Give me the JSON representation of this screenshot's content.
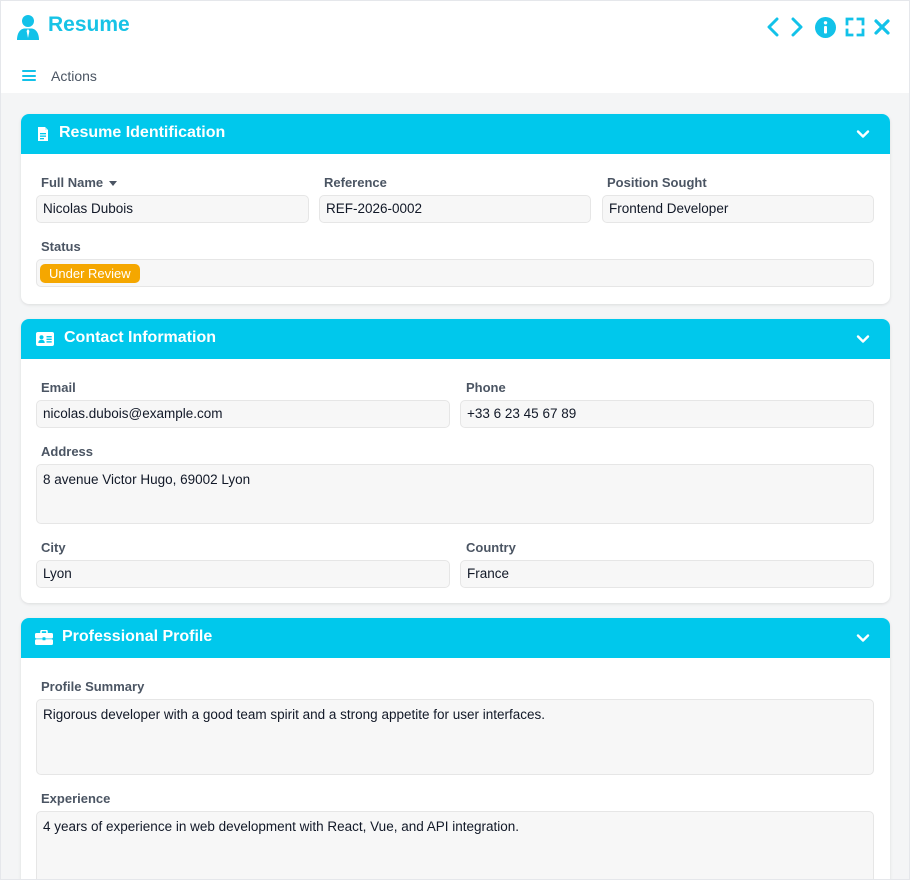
{
  "window": {
    "title": "Resume",
    "accent_color": "#00c8ec",
    "controls": [
      "chevron-left-icon",
      "chevron-right-icon",
      "info-icon",
      "fullscreen-icon",
      "close-icon"
    ]
  },
  "actions": {
    "label": "Actions"
  },
  "sections": {
    "identification": {
      "title": "Resume Identification",
      "icon": "document-icon",
      "full_name": {
        "label": "Full Name",
        "value": "Nicolas Dubois"
      },
      "reference": {
        "label": "Reference",
        "value": "REF-2026-0002"
      },
      "position": {
        "label": "Position Sought",
        "value": "Frontend Developer"
      },
      "status": {
        "label": "Status",
        "value": "Under Review",
        "color": "#f5a700"
      }
    },
    "contact": {
      "title": "Contact Information",
      "icon": "id-card-icon",
      "email": {
        "label": "Email",
        "value": "nicolas.dubois@example.com"
      },
      "phone": {
        "label": "Phone",
        "value": "+33 6 23 45 67 89"
      },
      "address": {
        "label": "Address",
        "value": "8 avenue Victor Hugo, 69002 Lyon"
      },
      "city": {
        "label": "City",
        "value": "Lyon"
      },
      "country": {
        "label": "Country",
        "value": "France"
      }
    },
    "profile": {
      "title": "Professional Profile",
      "icon": "briefcase-icon",
      "summary": {
        "label": "Profile Summary",
        "value": "Rigorous developer with a good team spirit and a strong appetite for user interfaces."
      },
      "experience": {
        "label": "Experience",
        "value": "4 years of experience in web development with React, Vue, and API integration."
      }
    }
  }
}
